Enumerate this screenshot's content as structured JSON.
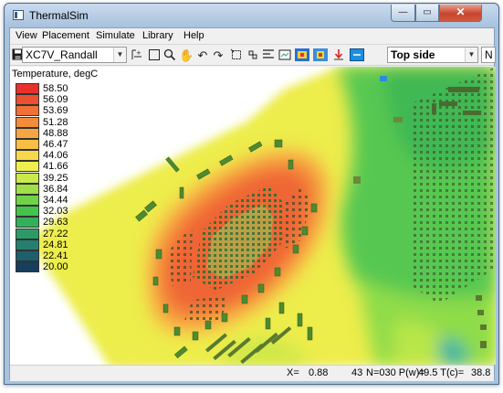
{
  "window": {
    "title": "ThermalSim",
    "min_glyph": "—",
    "max_glyph": "▭",
    "close_glyph": "✕"
  },
  "menu": [
    "View",
    "Placement",
    "Simulate",
    "Library",
    "Help"
  ],
  "toolbar": {
    "design_name": "XC7V_Randall",
    "view_side": "Top side",
    "net_value": "N",
    "icons": [
      "save-icon",
      "component-add-icon",
      "select-rectangle-icon",
      "zoom-icon",
      "pan-hand-icon",
      "rotate-left-icon",
      "rotate-right-icon",
      "rectangle-select-icon",
      "move-icon",
      "arrange-icon",
      "map-view-icon",
      "thermal-palette-icon",
      "chip-icon",
      "download-icon",
      "blue-screen-icon"
    ]
  },
  "legend": {
    "title": "Temperature, degC",
    "entries": [
      {
        "value": "58.50",
        "color": "#e8322b"
      },
      {
        "value": "56.09",
        "color": "#ec5030"
      },
      {
        "value": "53.69",
        "color": "#f07036"
      },
      {
        "value": "51.28",
        "color": "#f48c3a"
      },
      {
        "value": "48.88",
        "color": "#f7a540"
      },
      {
        "value": "46.47",
        "color": "#f9bf45"
      },
      {
        "value": "44.06",
        "color": "#f7d84a"
      },
      {
        "value": "41.66",
        "color": "#eeee4e"
      },
      {
        "value": "39.25",
        "color": "#c9ea48"
      },
      {
        "value": "36.84",
        "color": "#9ee045"
      },
      {
        "value": "34.44",
        "color": "#6fd445"
      },
      {
        "value": "32.03",
        "color": "#44c44a"
      },
      {
        "value": "29.63",
        "color": "#33b05a"
      },
      {
        "value": "27.22",
        "color": "#2b9a66"
      },
      {
        "value": "24.81",
        "color": "#267f6e"
      },
      {
        "value": "22.41",
        "color": "#1e5f6c"
      },
      {
        "value": "20.00",
        "color": "#173e5c"
      }
    ]
  },
  "status": {
    "x_label": "X=",
    "x_value": "0.88",
    "segment2": "43",
    "segment3": "N=030 P(w)=",
    "segment4": "49.5 T(c)=",
    "segment5": "38.8"
  }
}
